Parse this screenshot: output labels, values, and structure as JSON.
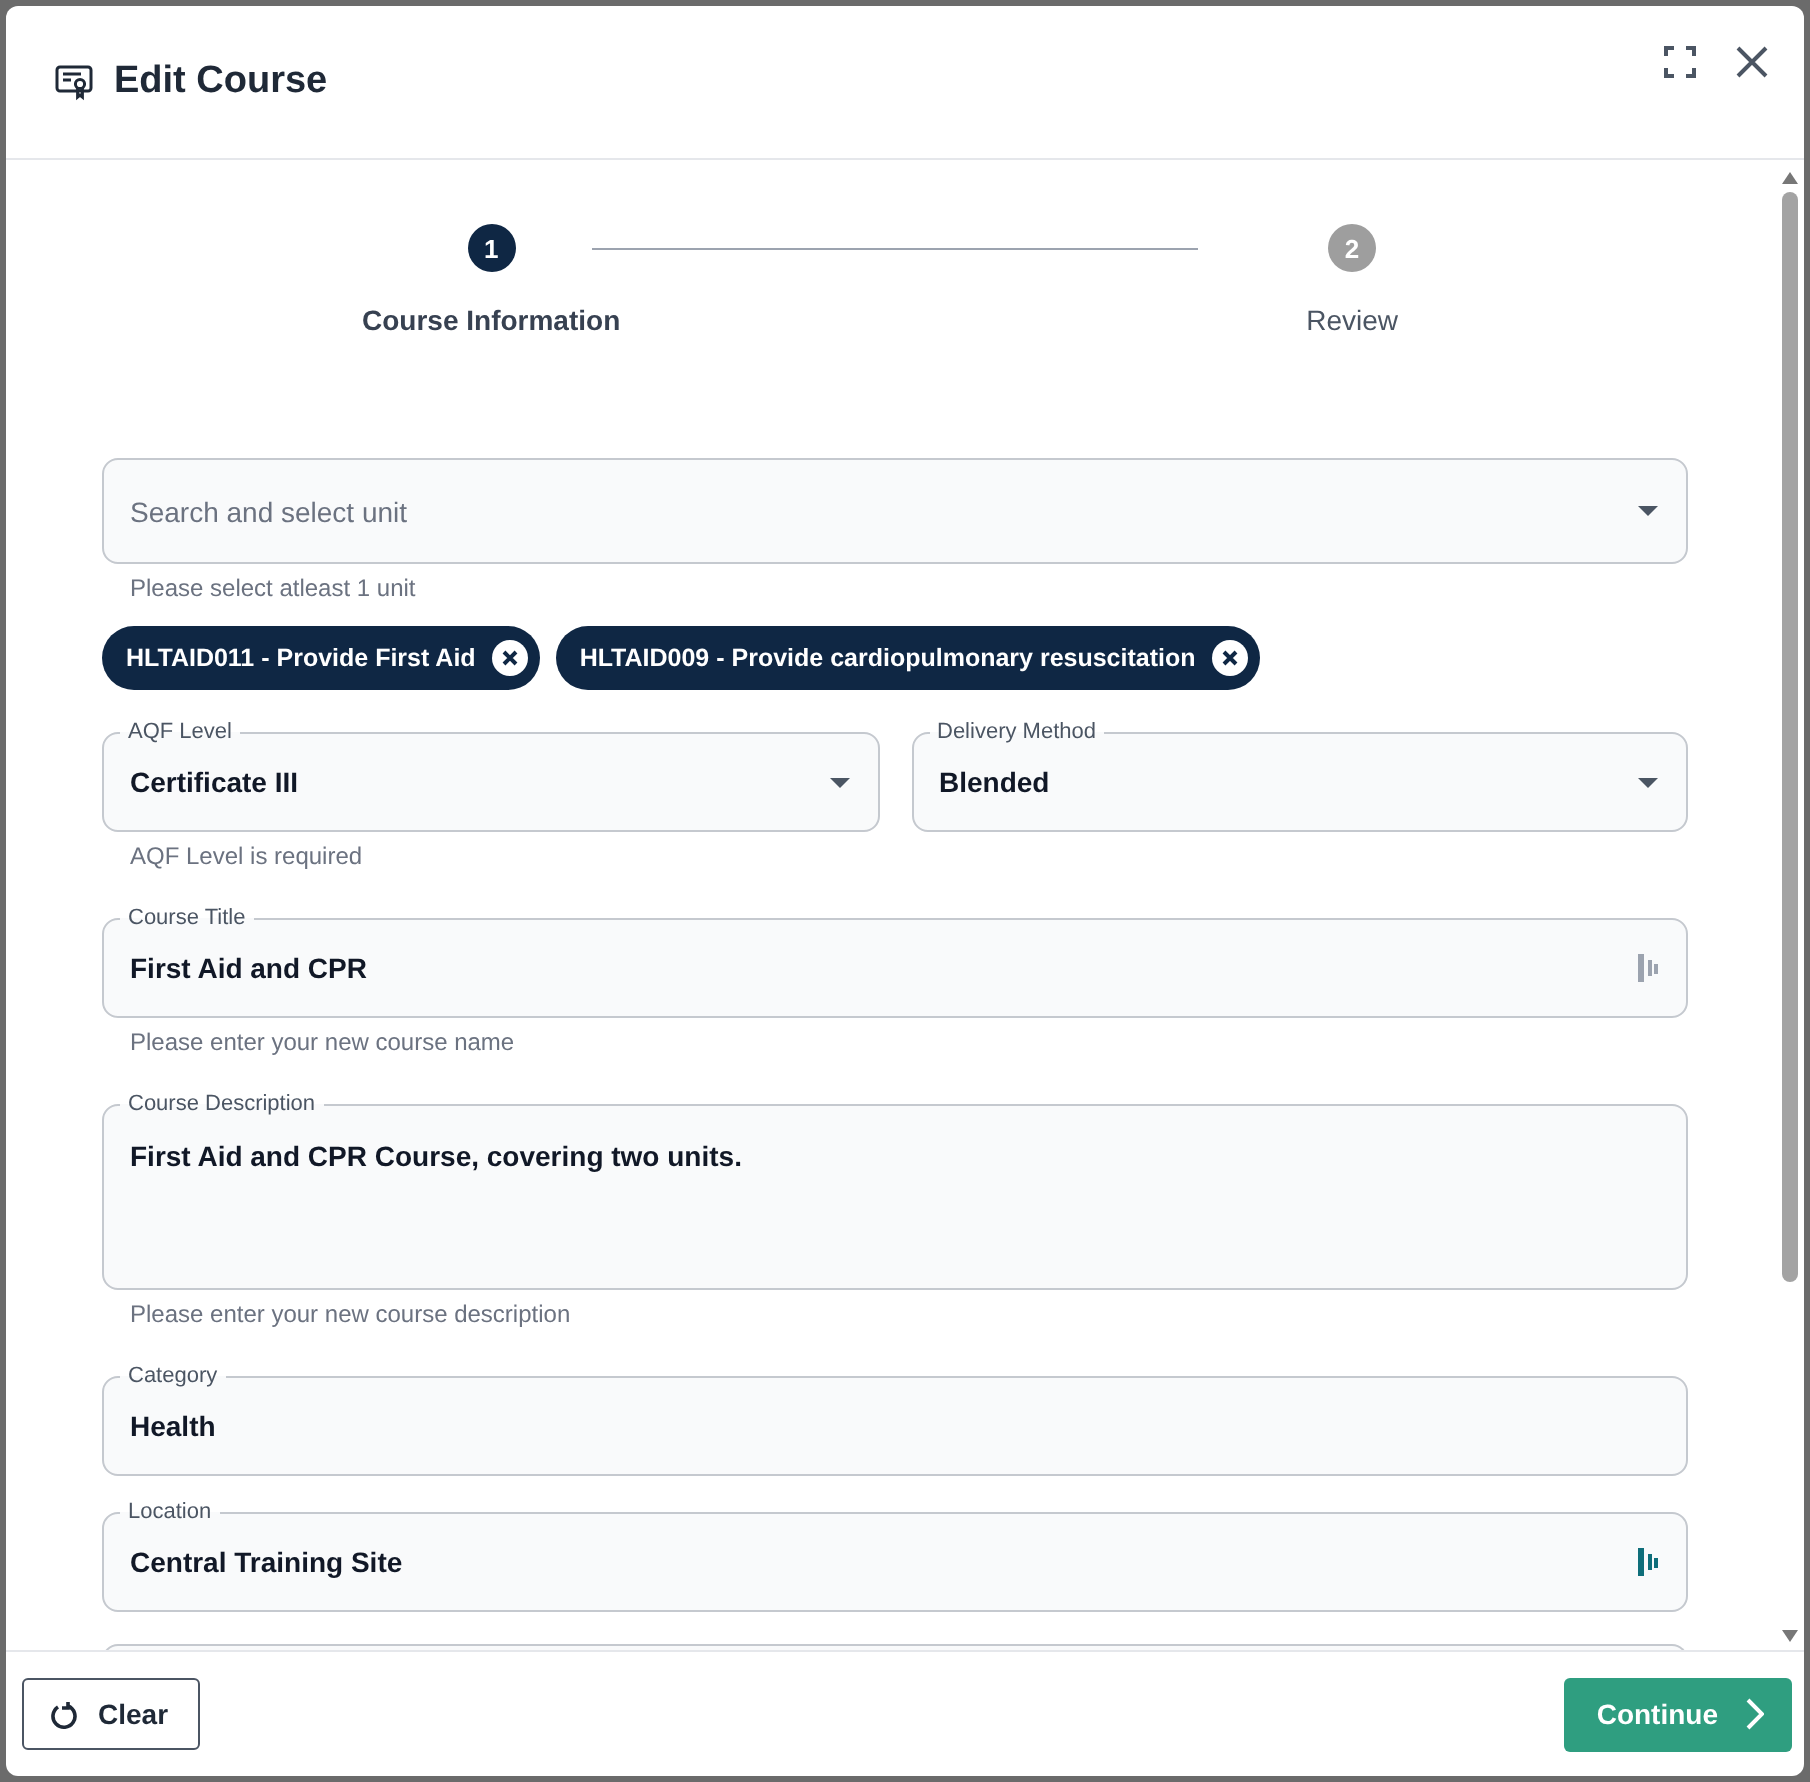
{
  "dialog": {
    "title": "Edit Course"
  },
  "steps": [
    {
      "number": "1",
      "label": "Course Information",
      "selected": true
    },
    {
      "number": "2",
      "label": "Review",
      "selected": false
    }
  ],
  "unit_select": {
    "placeholder": "Search and select unit",
    "helper": "Please select atleast 1 unit"
  },
  "chips": [
    {
      "label": "HLTAID011 - Provide First Aid"
    },
    {
      "label": "HLTAID009 - Provide cardiopulmonary resuscitation"
    }
  ],
  "selects": [
    {
      "label": "AQF Level",
      "value": "Certificate III",
      "helper": "AQF Level is required"
    },
    {
      "label": "Delivery Method",
      "value": "Blended"
    }
  ],
  "fields": [
    {
      "kind": "text",
      "label": "Course Title",
      "value": "First Aid and CPR",
      "helper": "Please enter your new course name",
      "icon_highlighted": false
    },
    {
      "kind": "textarea",
      "label": "Course Description",
      "value": "First Aid and CPR Course, covering two units.",
      "helper": "Please enter your new course description"
    },
    {
      "kind": "plain",
      "label": "Category",
      "value": "Health"
    },
    {
      "kind": "text",
      "label": "Location",
      "value": "Central Training Site",
      "icon_highlighted": true
    },
    {
      "kind": "partial"
    }
  ],
  "footer": {
    "clear": "Clear",
    "continue": "Continue"
  }
}
